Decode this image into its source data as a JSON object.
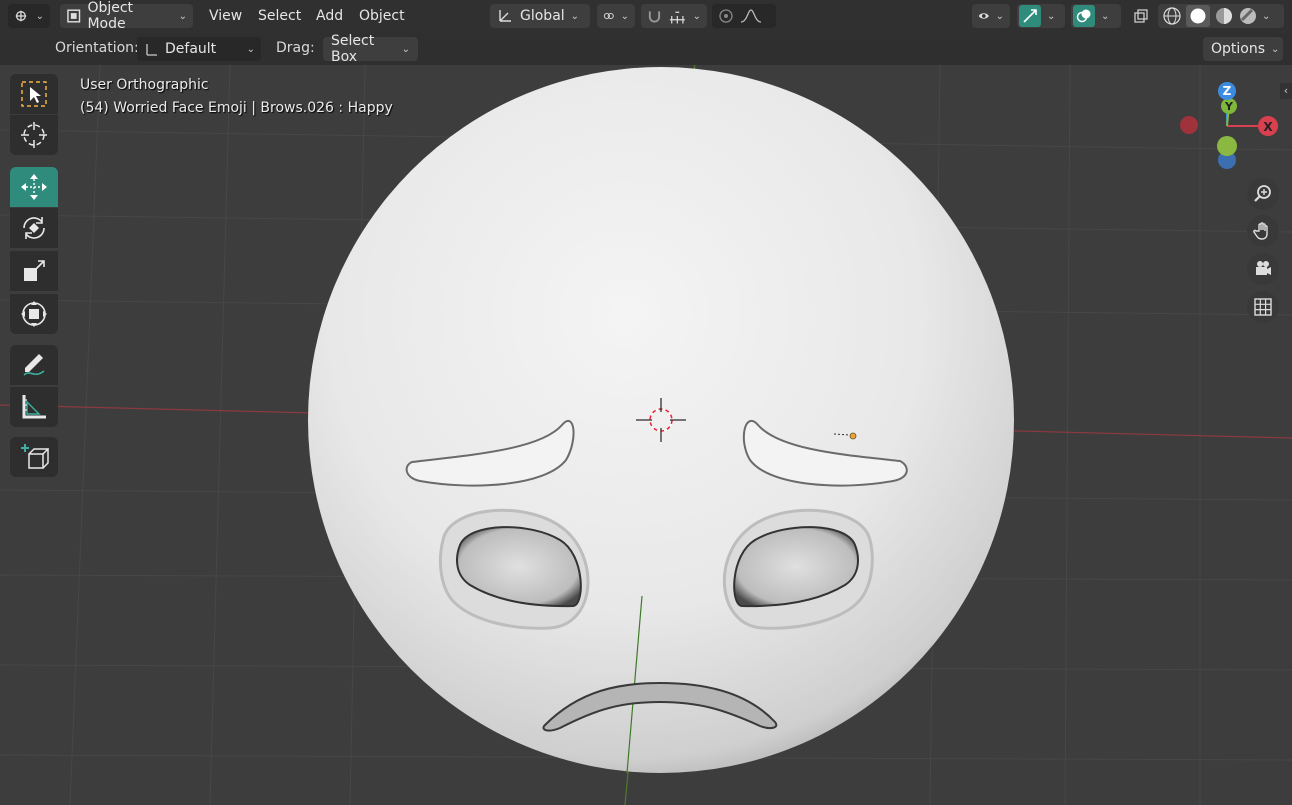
{
  "header": {
    "editor_type_icon": "editor-type-icon",
    "mode": "Object Mode",
    "menus": [
      "View",
      "Select",
      "Add",
      "Object"
    ],
    "transform_orientation": "Global"
  },
  "subheader": {
    "orientation_label": "Orientation:",
    "orientation_value": "Default",
    "drag_label": "Drag:",
    "drag_value": "Select Box",
    "options_label": "Options"
  },
  "viewport": {
    "view_name": "User Orthographic",
    "object_info": "(54) Worried Face Emoji | Brows.026 : Happy"
  },
  "gizmo": {
    "z": "Z",
    "y": "Y",
    "x": "X"
  },
  "colors": {
    "header_bg": "#303030",
    "viewport_bg": "#3d3d3d",
    "active_tool": "#2f8c7c",
    "x_axis": "#d9404f",
    "y_axis": "#7fb83a",
    "z_axis": "#3b8ce0"
  }
}
